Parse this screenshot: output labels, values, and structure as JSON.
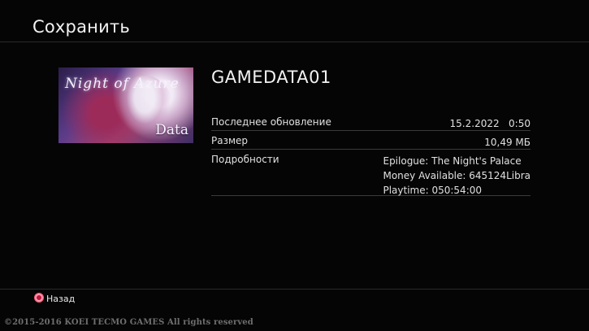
{
  "header": {
    "title": "Сохранить"
  },
  "save": {
    "name": "GAMEDATA01",
    "thumbnail": {
      "logo_text": "Night of Azure",
      "badge": "Data"
    },
    "details": {
      "last_update_label": "Последнее обновление",
      "last_update_value": "15.2.2022   0:50",
      "size_label": "Размер",
      "size_value": "10,49 МБ",
      "info_label": "Подробности",
      "info_lines": [
        "Epilogue: The Night's Palace",
        "Money Available: 645124Libra",
        "Playtime: 050:54:00"
      ]
    }
  },
  "footer": {
    "back_icon": "circle-button-icon",
    "back_label": "Назад",
    "copyright": "©2015-2016 KOEI TECMO GAMES All rights reserved"
  },
  "colors": {
    "background": "#050505",
    "accent_circle": "#c0163e"
  }
}
